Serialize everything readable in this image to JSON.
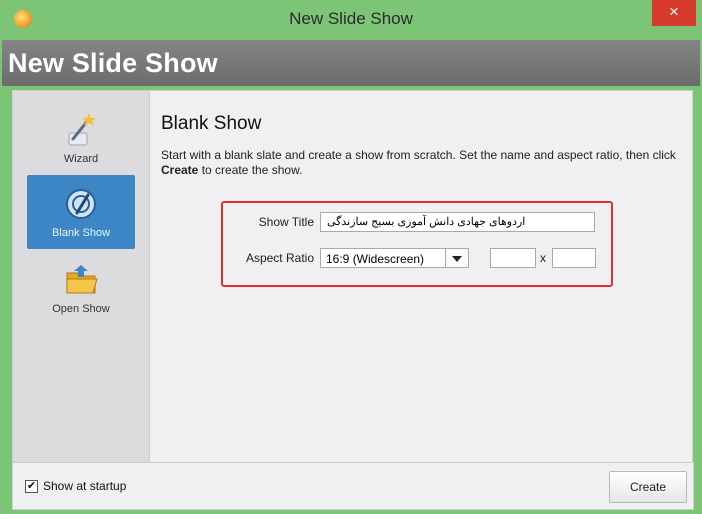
{
  "window": {
    "title": "New Slide Show",
    "close_glyph": "×"
  },
  "header": {
    "title": "New Slide Show"
  },
  "sidebar": {
    "items": [
      {
        "label": "Wizard",
        "icon": "wizard-wand-icon"
      },
      {
        "label": "Blank Show",
        "icon": "blank-show-icon",
        "active": true
      },
      {
        "label": "Open Show",
        "icon": "open-folder-icon"
      }
    ]
  },
  "main": {
    "title": "Blank Show",
    "description_pre": "Start with a blank slate and create a show from scratch. Set the name and aspect ratio, then click ",
    "description_bold": "Create",
    "description_post": " to create the show.",
    "show_title_label": "Show Title",
    "show_title_value": "اردوهای جهادی دانش آموزی بسیج سازندگی",
    "aspect_ratio_label": "Aspect Ratio",
    "aspect_ratio_value": "16:9 (Widescreen)",
    "width_value": "",
    "x_label": "x",
    "height_value": ""
  },
  "footer": {
    "show_at_startup_label": "Show at startup",
    "show_at_startup_checked": true,
    "check_glyph": "✔",
    "create_label": "Create"
  },
  "colors": {
    "accent_green": "#7cc576",
    "header_gray": "#6c6c6c",
    "active_blue": "#3d86c6",
    "highlight_red": "#e0302f",
    "close_red": "#d63b2d"
  }
}
